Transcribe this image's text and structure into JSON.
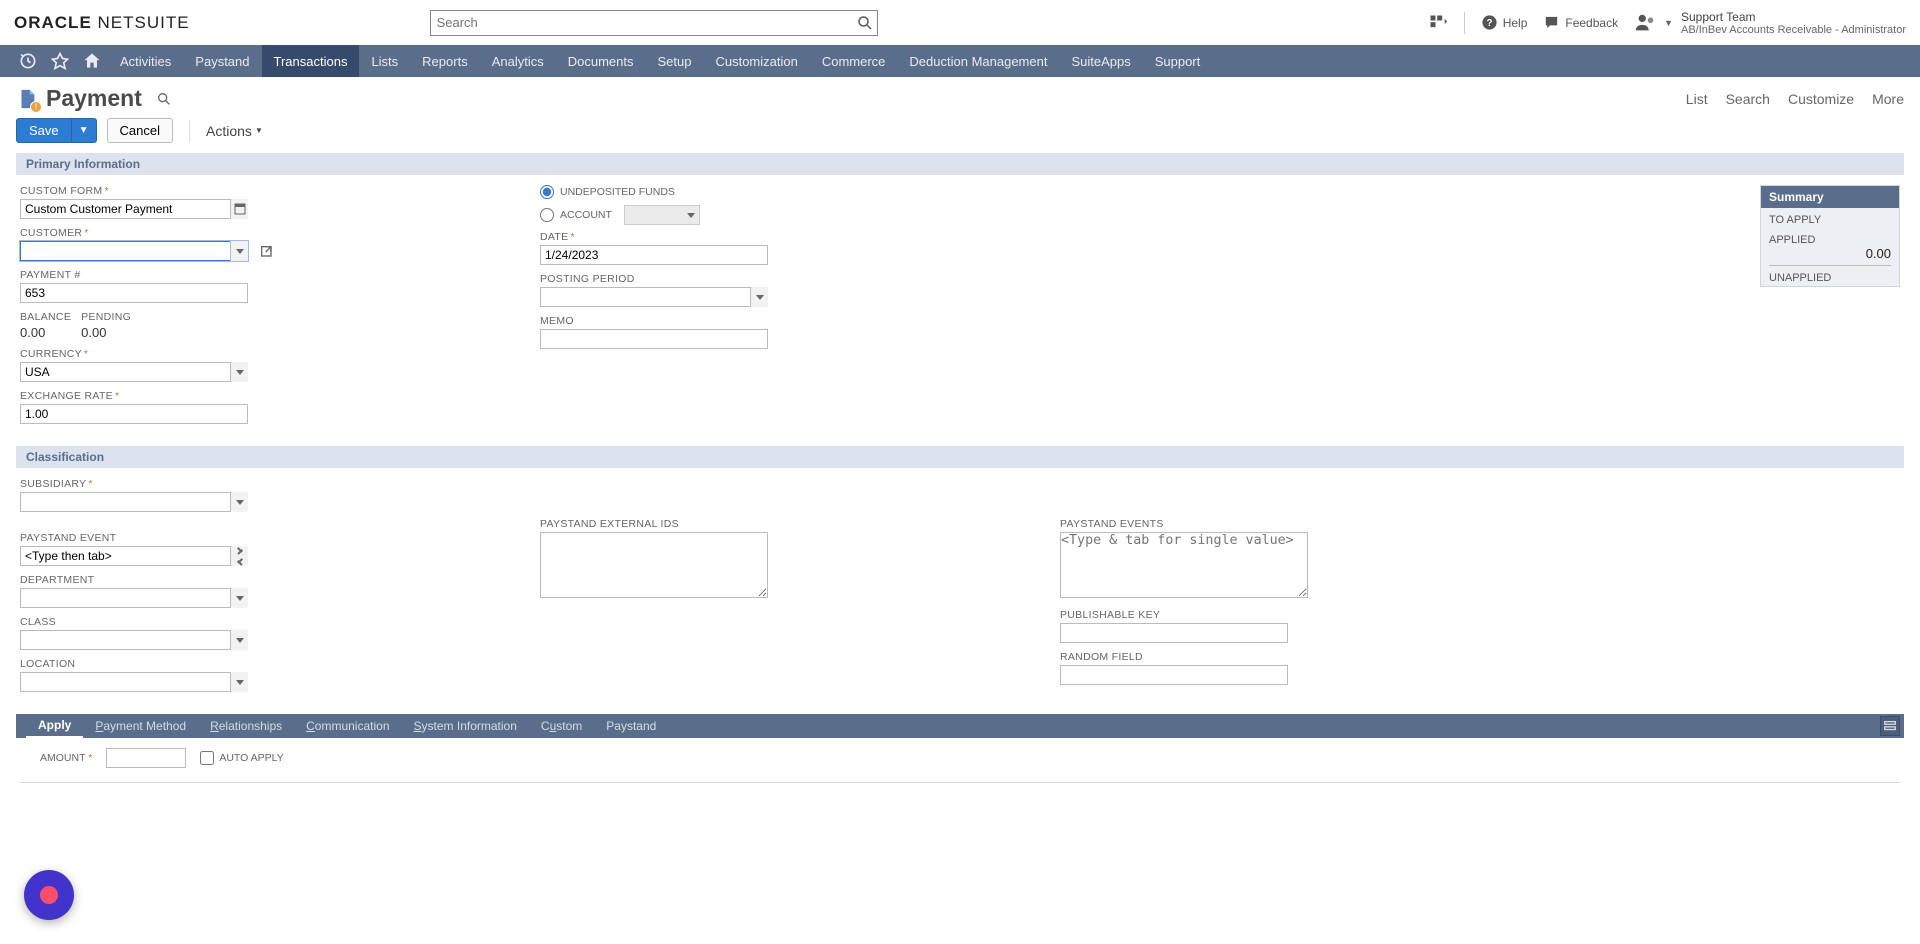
{
  "header": {
    "logo_prefix": "ORACLE",
    "logo_main": "NETSUITE",
    "search_placeholder": "Search",
    "help_label": "Help",
    "feedback_label": "Feedback",
    "user_name": "Support Team",
    "user_role": "AB/InBev Accounts Receivable - Administrator"
  },
  "nav": {
    "items": [
      "Activities",
      "Paystand",
      "Transactions",
      "Lists",
      "Reports",
      "Analytics",
      "Documents",
      "Setup",
      "Customization",
      "Commerce",
      "Deduction Management",
      "SuiteApps",
      "Support"
    ],
    "active_index": 2
  },
  "page": {
    "title": "Payment",
    "right_links": [
      "List",
      "Search",
      "Customize",
      "More"
    ],
    "save_label": "Save",
    "cancel_label": "Cancel",
    "actions_label": "Actions"
  },
  "sections": {
    "primary_title": "Primary Information",
    "classification_title": "Classification"
  },
  "primary": {
    "custom_form_label": "CUSTOM FORM",
    "custom_form_value": "Custom Customer Payment",
    "customer_label": "CUSTOMER",
    "customer_value": "",
    "payment_no_label": "PAYMENT #",
    "payment_no_value": "653",
    "balance_label": "BALANCE",
    "balance_value": "0.00",
    "pending_label": "PENDING",
    "pending_value": "0.00",
    "currency_label": "CURRENCY",
    "currency_value": "USA",
    "exchange_rate_label": "EXCHANGE RATE",
    "exchange_rate_value": "1.00",
    "undeposited_label": "UNDEPOSITED FUNDS",
    "account_label": "ACCOUNT",
    "date_label": "DATE",
    "date_value": "1/24/2023",
    "posting_period_label": "POSTING PERIOD",
    "posting_period_value": "",
    "memo_label": "MEMO",
    "memo_value": ""
  },
  "summary": {
    "title": "Summary",
    "to_apply_label": "TO APPLY",
    "applied_label": "APPLIED",
    "applied_value": "0.00",
    "unapplied_label": "UNAPPLIED"
  },
  "classification": {
    "subsidiary_label": "SUBSIDIARY",
    "paystand_event_label": "PAYSTAND EVENT",
    "paystand_event_placeholder": "<Type then tab>",
    "department_label": "DEPARTMENT",
    "class_label": "CLASS",
    "location_label": "LOCATION",
    "paystand_external_ids_label": "PAYSTAND EXTERNAL IDS",
    "paystand_events_label": "PAYSTAND EVENTS",
    "paystand_events_placeholder": "<Type & tab for single value>",
    "publishable_key_label": "PUBLISHABLE KEY",
    "random_field_label": "RANDOM FIELD"
  },
  "bottom_tabs": {
    "items": [
      "Apply",
      "Payment Method",
      "Relationships",
      "Communication",
      "System Information",
      "Custom",
      "Paystand"
    ],
    "active_index": 0
  },
  "apply": {
    "amount_label": "AMOUNT",
    "amount_value": "",
    "auto_apply_label": "AUTO APPLY"
  }
}
